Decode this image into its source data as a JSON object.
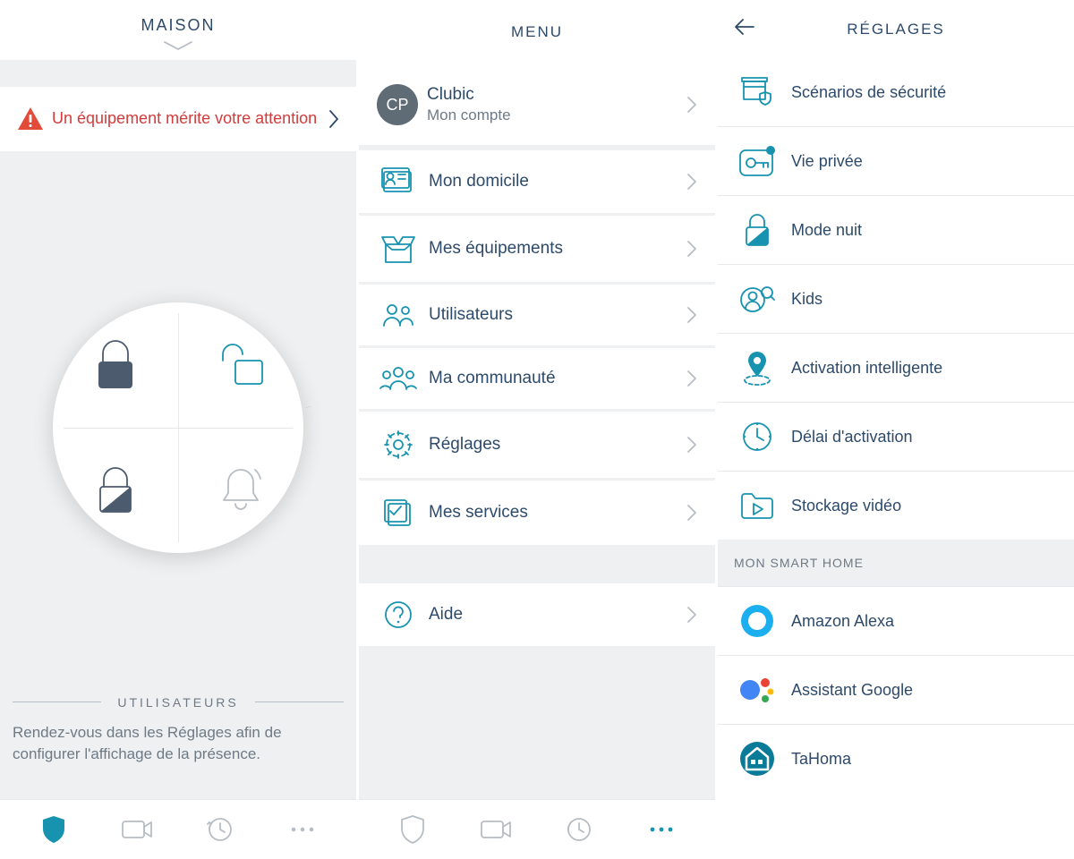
{
  "colors": {
    "teal": "#1793b0",
    "navy": "#2d4a6b",
    "red": "#d43b3b"
  },
  "screen1": {
    "header_title": "MAISON",
    "alert_text": "Un équipement mérite votre attention",
    "users_heading": "UTILISATEURS",
    "users_hint": "Rendez-vous dans les Réglages afin de configurer l'affichage de la présence.",
    "dial": {
      "q1": "locked-icon",
      "q2": "unlocked-icon",
      "q3": "partial-lock-icon",
      "q4": "bell-icon"
    },
    "tabs": [
      "shield-icon",
      "camera-icon",
      "history-icon",
      "more-icon"
    ],
    "active_tab": 0
  },
  "screen2": {
    "header_title": "MENU",
    "profile": {
      "initials": "CP",
      "name": "Clubic",
      "subtitle": "Mon compte"
    },
    "items": [
      {
        "icon": "home-id-icon",
        "label": "Mon domicile"
      },
      {
        "icon": "box-icon",
        "label": "Mes équipements"
      },
      {
        "icon": "users-icon",
        "label": "Utilisateurs"
      },
      {
        "icon": "community-icon",
        "label": "Ma communauté"
      },
      {
        "icon": "gear-icon",
        "label": "Réglages"
      },
      {
        "icon": "checklist-icon",
        "label": "Mes services"
      }
    ],
    "help": {
      "icon": "help-icon",
      "label": "Aide"
    },
    "tabs": [
      "shield-icon",
      "camera-icon",
      "history-icon",
      "more-icon"
    ],
    "active_tab": 3
  },
  "screen3": {
    "header_title": "RÉGLAGES",
    "group1": [
      {
        "icon": "security-scenario-icon",
        "label": "Scénarios de sécurité"
      },
      {
        "icon": "privacy-icon",
        "label": "Vie privée"
      },
      {
        "icon": "night-mode-icon",
        "label": "Mode nuit"
      },
      {
        "icon": "kids-icon",
        "label": "Kids"
      },
      {
        "icon": "smart-activation-icon",
        "label": "Activation intelligente"
      },
      {
        "icon": "delay-icon",
        "label": "Délai d'activation"
      },
      {
        "icon": "video-storage-icon",
        "label": "Stockage vidéo"
      }
    ],
    "section_label": "MON SMART HOME",
    "group2": [
      {
        "icon": "alexa-icon",
        "label": "Amazon Alexa"
      },
      {
        "icon": "google-assistant-icon",
        "label": "Assistant Google"
      },
      {
        "icon": "tahoma-icon",
        "label": "TaHoma"
      }
    ]
  }
}
